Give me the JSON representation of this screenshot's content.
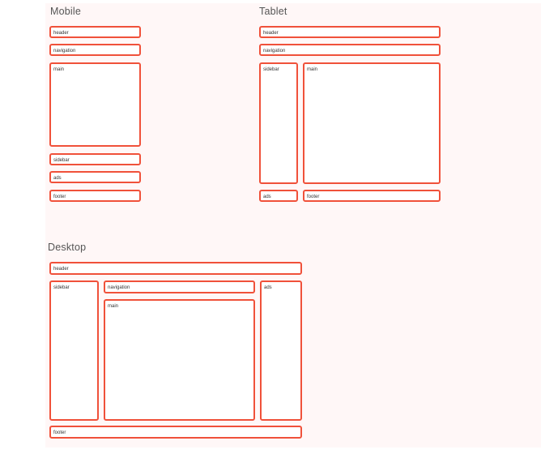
{
  "mobile": {
    "title": "Mobile",
    "header": "header",
    "navigation": "navigation",
    "main": "main",
    "sidebar": "sidebar",
    "ads": "ads",
    "footer": "footer"
  },
  "tablet": {
    "title": "Tablet",
    "header": "header",
    "navigation": "navigation",
    "sidebar": "sidebar",
    "main": "main",
    "ads": "ads",
    "footer": "footer"
  },
  "desktop": {
    "title": "Desktop",
    "header": "header",
    "sidebar": "sidebar",
    "navigation": "navigation",
    "main": "main",
    "ads": "ads",
    "footer": "footer"
  },
  "colors": {
    "accent": "#f0513a",
    "canvas": "#fff7f7"
  }
}
